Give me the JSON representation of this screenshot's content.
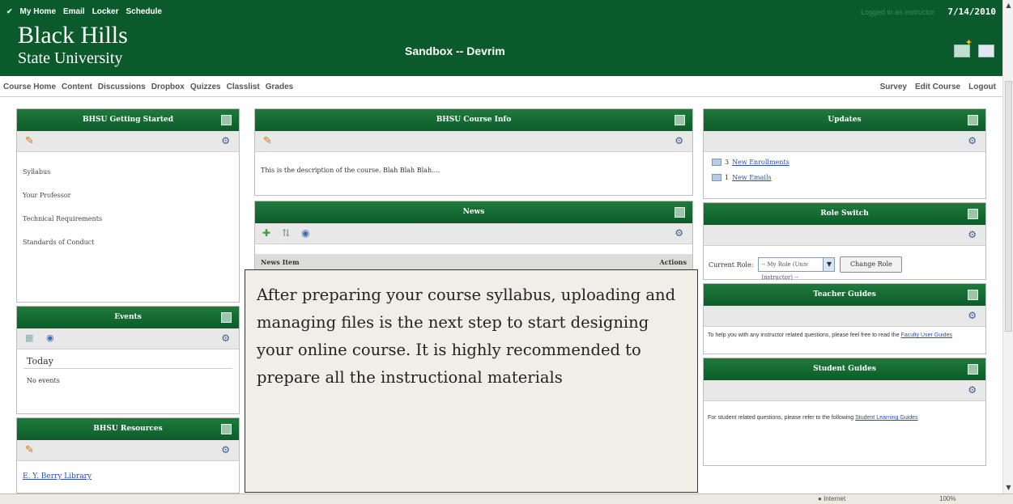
{
  "header": {
    "topnav": [
      "My Home",
      "Email",
      "Locker",
      "Schedule"
    ],
    "logged_in": "Logged in as instructor",
    "date": "7/14/2010",
    "logo_line1": "Black Hills",
    "logo_line2": "State University",
    "course_title": "Sandbox -- Devrim"
  },
  "coursenav": {
    "left": [
      "Course Home",
      "Content",
      "Discussions",
      "Dropbox",
      "Quizzes",
      "Classlist",
      "Grades"
    ],
    "right": [
      "Survey",
      "Edit Course",
      "Logout"
    ]
  },
  "getting_started": {
    "title": "BHSU Getting Started",
    "links": [
      "Syllabus",
      "Your Professor",
      "Technical Requirements",
      "Standards of Conduct"
    ]
  },
  "events": {
    "title": "Events",
    "today": "Today",
    "none": "No events"
  },
  "resources": {
    "title": "BHSU Resources",
    "link": "E. Y. Berry Library"
  },
  "course_info": {
    "title": "BHSU Course Info",
    "description": "This is the description of the course. Blah Blah Blah...."
  },
  "news": {
    "title": "News",
    "col_item": "News Item",
    "col_actions": "Actions"
  },
  "updates": {
    "title": "Updates",
    "enroll_count": "3",
    "enroll_label": "New Enrollments",
    "email_count": "1",
    "email_label": "New Emails"
  },
  "role_switch": {
    "title": "Role Switch",
    "label": "Current Role:",
    "selected": "-- My Role (Univ Instructor) --",
    "button": "Change Role"
  },
  "teacher_guides": {
    "title": "Teacher Guides",
    "text": "To help you with any instructor related questions, please feel free to read the",
    "link": "Faculty User Guides"
  },
  "student_guides": {
    "title": "Student Guides",
    "text": "For student related questions, please refer to the following",
    "link": "Student Learning Guides"
  },
  "callout": {
    "text": "After preparing your course syllabus, uploading and managing files is the next step to start designing your online course. It is highly recommended to prepare all the instructional materials"
  },
  "statusbar": {
    "zone": "Internet",
    "zoom": "100%"
  },
  "colors": {
    "brand_green": "#0b5a2c",
    "link_blue": "#2a4db5"
  }
}
